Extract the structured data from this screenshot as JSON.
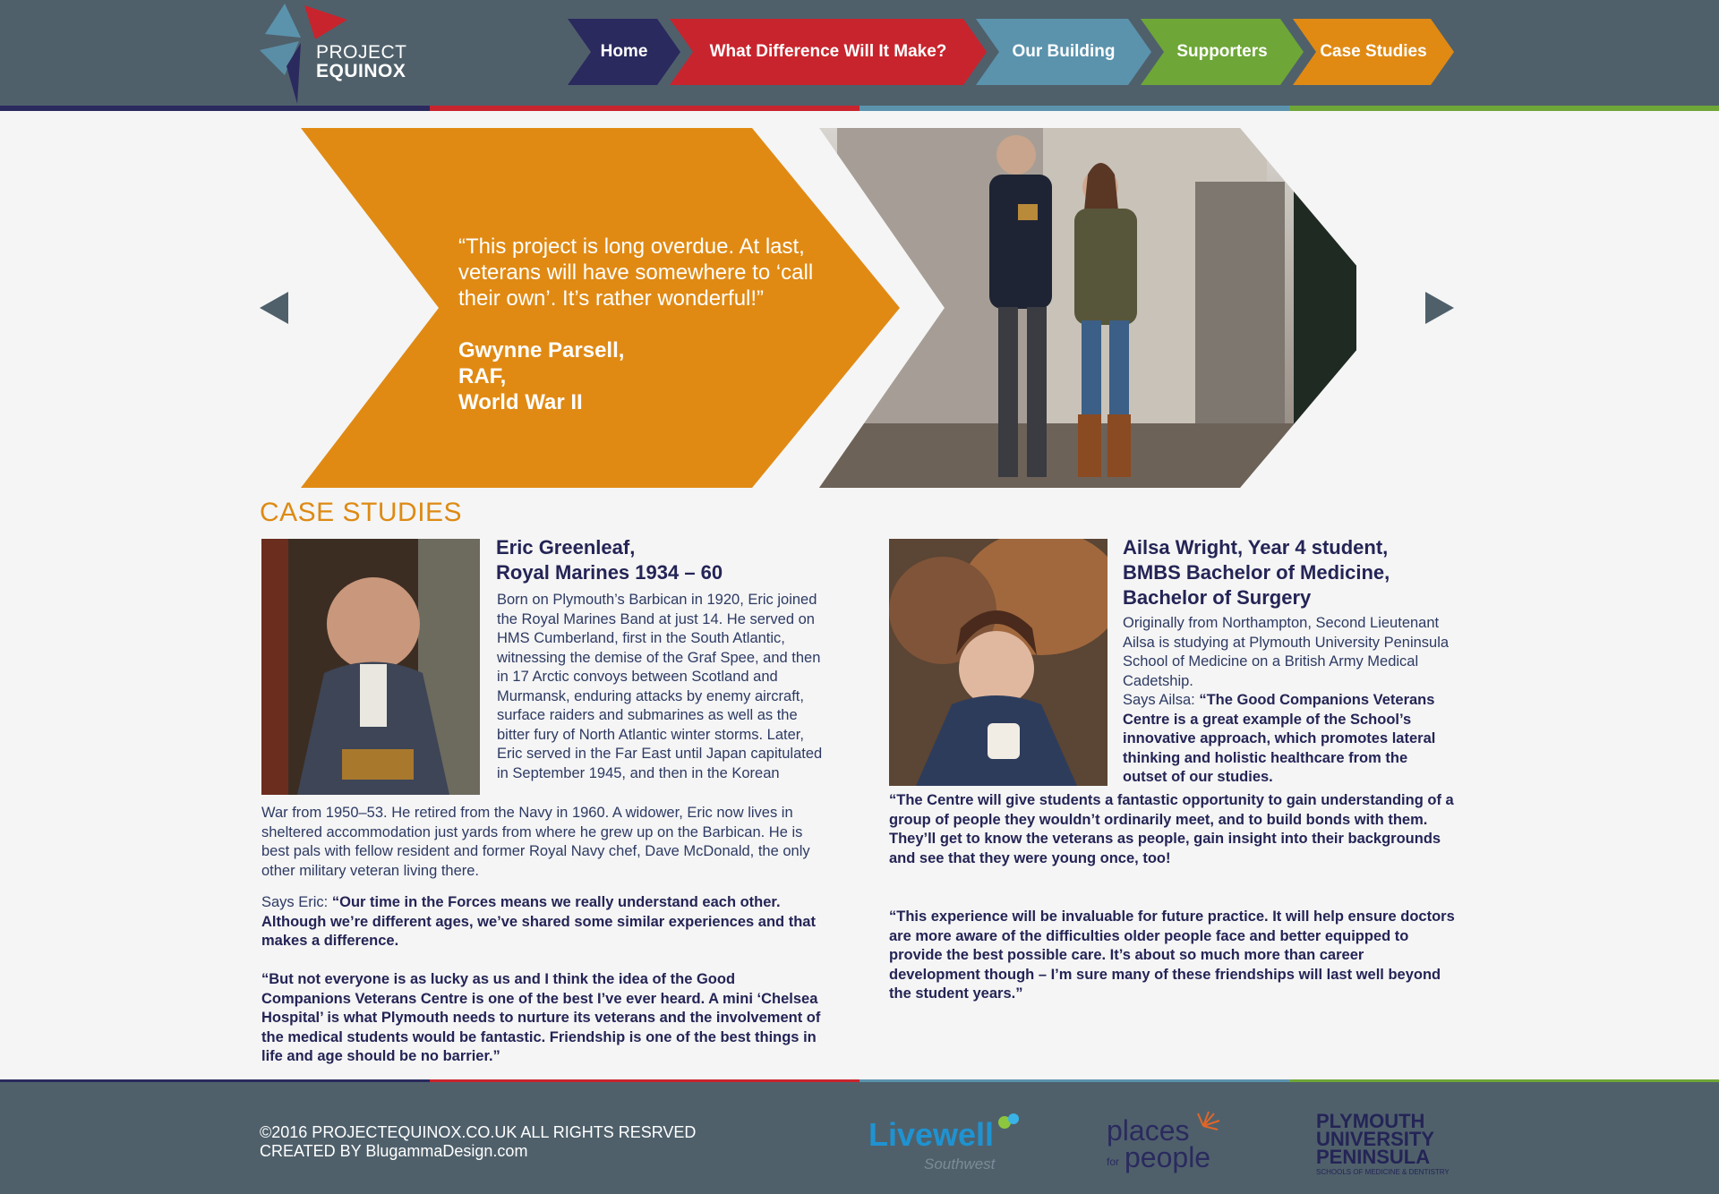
{
  "header": {
    "logo": {
      "line1": "PROJECT",
      "line2": "EQUINOX"
    },
    "nav": [
      {
        "label": "Home",
        "color": "#2a2a5e"
      },
      {
        "label": "What Difference Will It Make?",
        "color": "#c8242d"
      },
      {
        "label": "Our Building",
        "color": "#5b93ad"
      },
      {
        "label": "Supporters",
        "color": "#6ea638"
      },
      {
        "label": "Case Studies",
        "color": "#e08a14"
      }
    ]
  },
  "hero": {
    "quote": "“This project is long overdue. At last, veterans will have somewhere to ‘call their own’. It’s rather wonderful!”",
    "author_lines": [
      "Gwynne Parsell,",
      "RAF,",
      "World War II"
    ],
    "accent": "#e08a14",
    "prev_icon": "triangle-left-icon",
    "next_icon": "triangle-right-icon"
  },
  "case_studies": {
    "title": "CASE STUDIES",
    "eric": {
      "name_line1": "Eric Greenleaf,",
      "name_line2": "Royal Marines 1934 – 60",
      "bio": "Born on Plymouth’s Barbican in 1920, Eric joined the Royal Marines Band at just 14. He served on HMS Cumberland, first in the South Atlantic, witnessing the demise of the Graf Spee, and then in 17 Arctic convoys between Scotland and Murmansk, enduring attacks by enemy aircraft, surface raiders and submarines as well as the bitter fury of North Atlantic winter storms. Later, Eric served in the Far East until Japan capitulated in September 1945, and then in the Korean",
      "bio_cont": "War from 1950–53. He retired from the Navy in 1960. A widower, Eric now lives in sheltered accommodation just yards from where he grew up on the Barbican. He is best pals with fellow resident and former Royal Navy chef, Dave McDonald, the only other military veteran living there.",
      "says_label": "Says Eric:",
      "quote1": "“Our time in the Forces means we really understand each other. Although we’re different ages, we’ve shared some similar experiences and that makes a difference.",
      "quote2": "“But not everyone is as lucky as us and I think the idea of the Good Companions Veterans Centre is one of the best I’ve ever heard. A mini ‘Chelsea Hospital’ is what Plymouth needs to nurture its veterans and the involvement of the medical students would be fantastic.  Friendship is one of the best things in life and age should be no barrier.”"
    },
    "ailsa": {
      "name_line1": "Ailsa Wright, Year 4 student,",
      "name_line2": "BMBS Bachelor of Medicine,",
      "name_line3": "Bachelor of Surgery",
      "bio": "Originally from Northampton, Second Lieutenant Ailsa is studying at Plymouth University Peninsula School of Medicine on a British Army Medical Cadetship.",
      "says_label": "Says Ailsa:",
      "quote1_start": "“The Good Companions Veterans Centre is a great example of the School’s innovative approach, which promotes lateral thinking and holistic healthcare from the outset of our studies.",
      "quote2": "“The Centre will give students a fantastic opportunity to gain understanding of a group of people they wouldn’t ordinarily meet, and to build bonds with them. They’ll get to know the veterans as people, gain insight into their backgrounds and see that they were young once, too!",
      "quote3": "“This experience will be invaluable for future practice. It will help ensure doctors are more aware of the difficulties older people face and better equipped to provide the best possible care. It’s about so much more than career development though – I’m sure many of these friendships will last well beyond the student years.”"
    }
  },
  "footer": {
    "copyright": "©2016 PROJECTEQUINOX.CO.UK ALL RIGHTS RESRVED",
    "credit": "CREATED BY BlugammaDesign.com",
    "sponsors": {
      "livewell": {
        "main": "Livewell",
        "sub": "Southwest"
      },
      "places": {
        "line1": "places",
        "line2": "people",
        "small": "for"
      },
      "plymouth": {
        "line1": "PLYMOUTH",
        "line2": "UNIVERSITY",
        "line3": "PENINSULA",
        "line4": "SCHOOLS OF MEDICINE & DENTISTRY"
      }
    }
  }
}
